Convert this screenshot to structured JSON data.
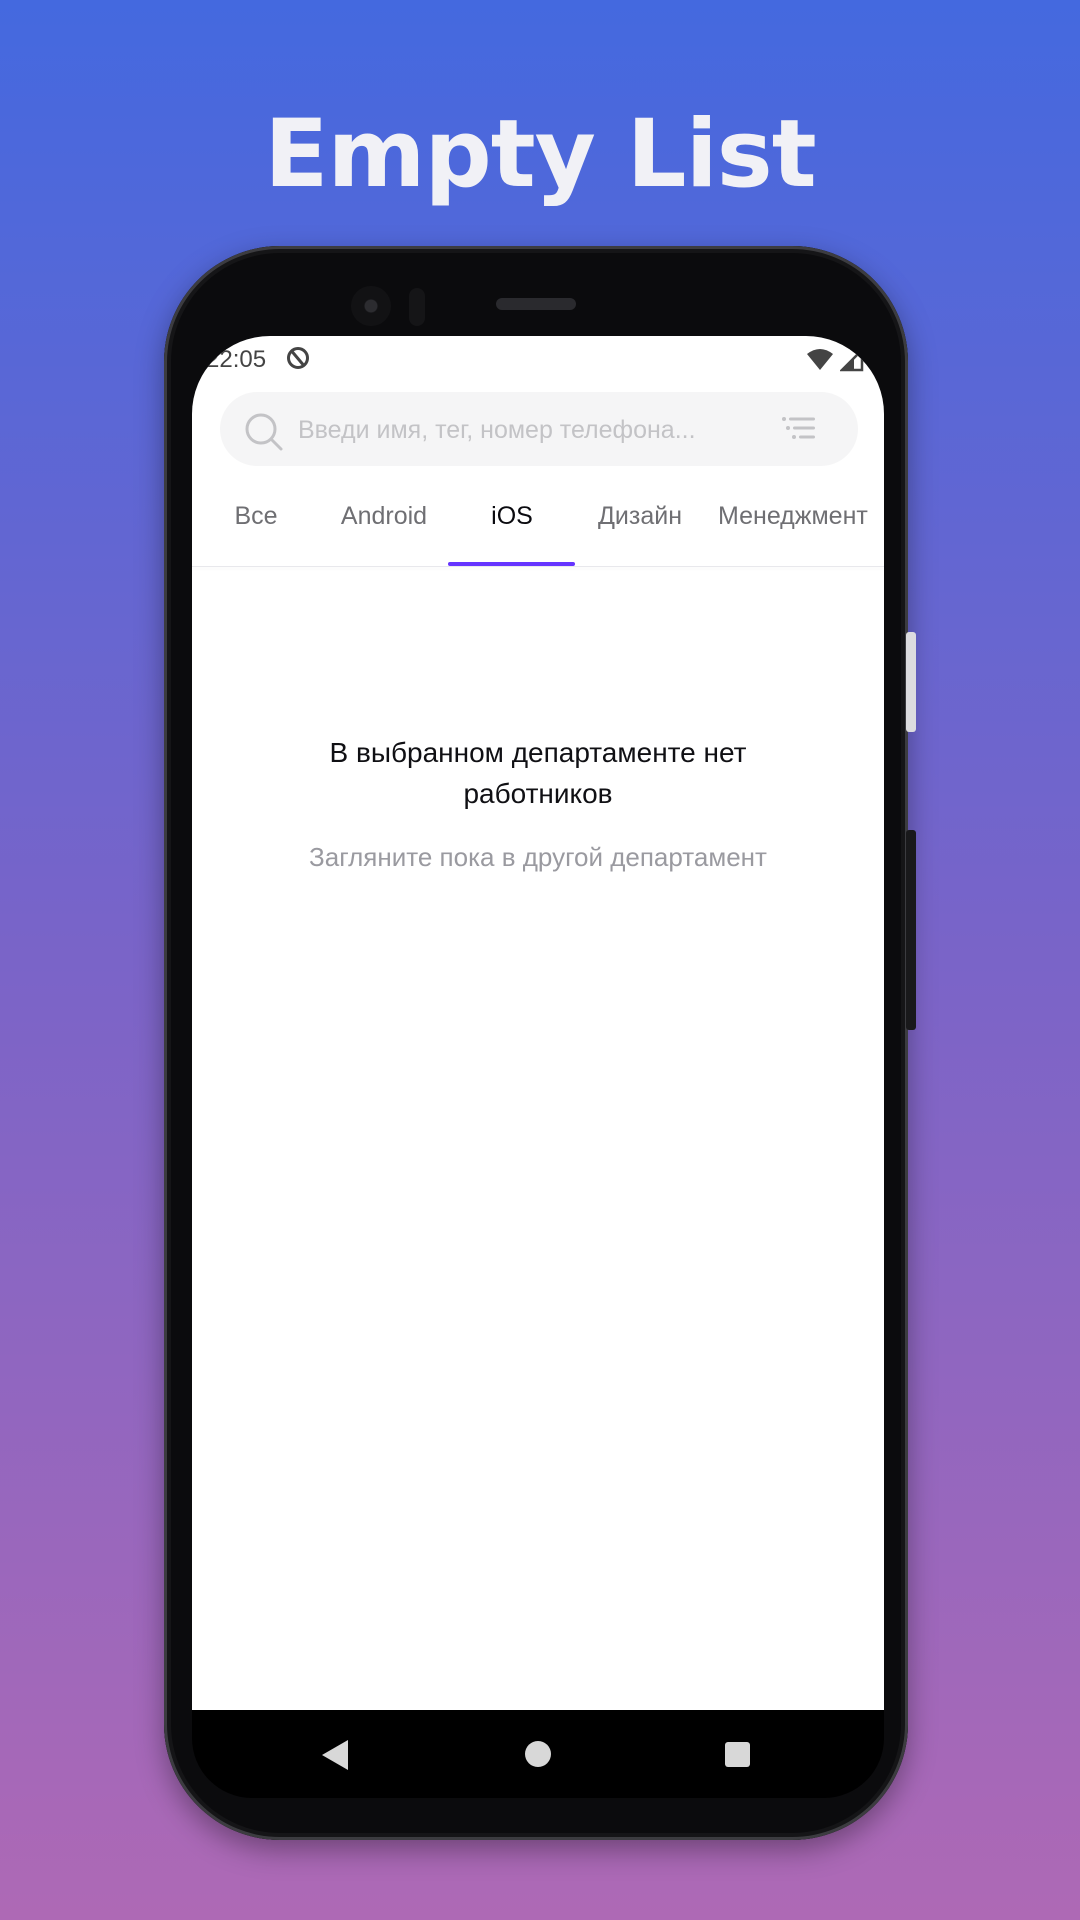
{
  "promo": {
    "title": "Empty List"
  },
  "status_bar": {
    "time": "22:05",
    "icons": [
      "app-notification-icon",
      "wifi-icon",
      "cellular-signal-icon",
      "battery-icon"
    ]
  },
  "search": {
    "placeholder": "Введи имя, тег, номер телефона...",
    "value": ""
  },
  "tabs": [
    {
      "label": "Все",
      "selected": false
    },
    {
      "label": "Android",
      "selected": false
    },
    {
      "label": "iOS",
      "selected": true
    },
    {
      "label": "Дизайн",
      "selected": false
    },
    {
      "label": "Менеджмент",
      "selected": false
    }
  ],
  "empty_state": {
    "title": "В выбранном департаменте нет работников",
    "subtitle": "Загляните пока в другой департамент"
  },
  "navigation": {
    "buttons": [
      "back-icon",
      "home-icon",
      "recents-icon"
    ]
  },
  "colors": {
    "accent": "#6534ff",
    "background_top": "#4469df",
    "background_bottom": "#ae69b5"
  }
}
